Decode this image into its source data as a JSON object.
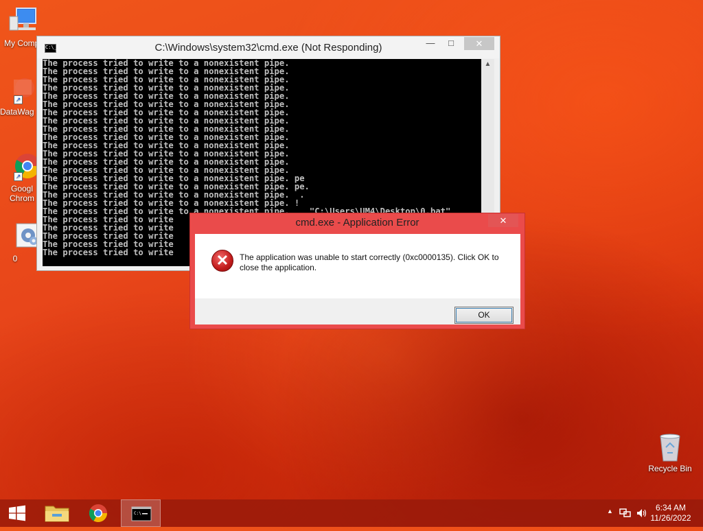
{
  "desktop": {
    "icons": [
      {
        "label": "My Comp",
        "icon": "computer-icon"
      },
      {
        "label": "DataWag",
        "icon": "datawag-icon"
      },
      {
        "label": "Googl Chrom",
        "icon": "chrome-icon"
      },
      {
        "label": "0",
        "icon": "settings-file-icon"
      },
      {
        "label": "Recycle Bin",
        "icon": "recycle-bin-icon"
      }
    ]
  },
  "cmd_window": {
    "title": "C:\\Windows\\system32\\cmd.exe (Not Responding)",
    "minimize": "—",
    "maximize": "□",
    "close": "✕",
    "console_lines": [
      "The process tried to write to a nonexistent pipe.",
      "The process tried to write to a nonexistent pipe.",
      "The process tried to write to a nonexistent pipe.",
      "The process tried to write to a nonexistent pipe.",
      "The process tried to write to a nonexistent pipe.",
      "The process tried to write to a nonexistent pipe.",
      "The process tried to write to a nonexistent pipe.",
      "The process tried to write to a nonexistent pipe.",
      "The process tried to write to a nonexistent pipe.",
      "The process tried to write to a nonexistent pipe.",
      "The process tried to write to a nonexistent pipe.",
      "The process tried to write to a nonexistent pipe.",
      "The process tried to write to a nonexistent pipe.",
      "The process tried to write to a nonexistent pipe.",
      "The process tried to write to a nonexistent pipe. pe",
      "The process tried to write to a nonexistent pipe. pe.",
      "The process tried to write to a nonexistent pipe.  .",
      "The process tried to write to a nonexistent pipe. !",
      "The process tried to write to a nonexistent pipe.    \"C:\\Users\\UM4\\Desktop\\0.bat\"",
      "The process tried to write",
      "The process tried to write",
      "The process tried to write",
      "The process tried to write",
      "The process tried to write"
    ]
  },
  "error_dialog": {
    "title": "cmd.exe - Application Error",
    "close": "✕",
    "message": "The application was unable to start correctly (0xc0000135). Click OK to close the application.",
    "ok_label": "OK",
    "icon": "error-icon"
  },
  "taskbar": {
    "items": [
      {
        "name": "start-button",
        "icon": "windows-logo-icon"
      },
      {
        "name": "file-explorer",
        "icon": "folder-icon"
      },
      {
        "name": "chrome",
        "icon": "chrome-icon"
      },
      {
        "name": "cmd",
        "icon": "cmd-icon",
        "active": true
      }
    ],
    "tray_arrow": "▲",
    "time": "6:34 AM",
    "date": "11/26/2022"
  },
  "colors": {
    "dialog_border": "#ea4b4b",
    "taskbar": "#96190a"
  }
}
